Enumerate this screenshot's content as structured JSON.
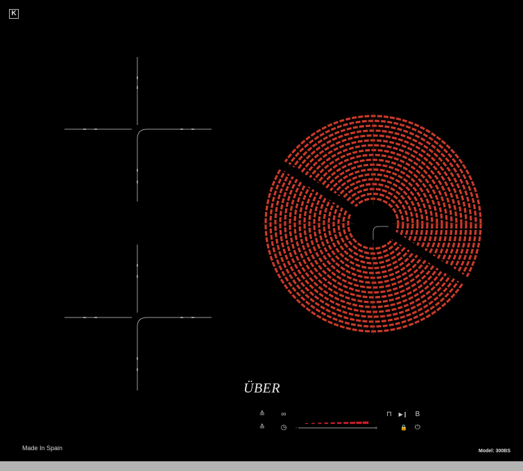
{
  "brand": {
    "name": "ÜBER"
  },
  "footer": {
    "origin": "Made In Spain",
    "model": "Model: 300BS"
  },
  "badge": {
    "icon": "k-logo-icon",
    "letter": "K"
  },
  "controls": {
    "top_row": [
      {
        "name": "zone-select-left-icon",
        "glyph": "≙"
      },
      {
        "name": "zone-bridge-icon",
        "glyph": "∞"
      }
    ],
    "bottom_row": [
      {
        "name": "zone-select-right-icon",
        "glyph": "≙"
      },
      {
        "name": "timer-icon",
        "glyph": "◷"
      }
    ],
    "right_top": [
      {
        "name": "pot-icon",
        "glyph": "⊓"
      },
      {
        "name": "pause-icon",
        "glyph": "▶❙"
      },
      {
        "name": "boost-label",
        "glyph": "B"
      }
    ],
    "right_bottom": [
      {
        "name": "lock-icon",
        "glyph": "🔒"
      },
      {
        "name": "power-icon",
        "glyph": "⏻"
      }
    ],
    "slider": {
      "min_label": "-",
      "max_label": "+"
    }
  },
  "colors": {
    "burner": "#c93a2a",
    "background": "#000000",
    "strip": "#b3b3b3",
    "slider_active": "#d11f2c"
  }
}
